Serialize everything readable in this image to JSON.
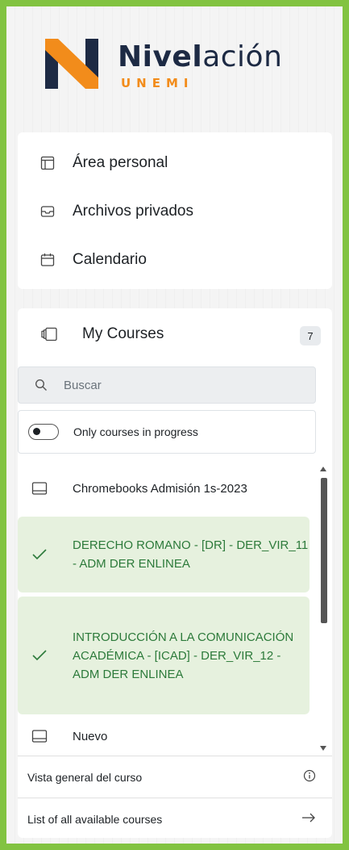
{
  "brand": {
    "word_bold": "Nivel",
    "word_rest": "ación",
    "sub": "UNEMI"
  },
  "nav": {
    "items": [
      {
        "label": "Área personal",
        "icon": "dashboard-icon"
      },
      {
        "label": "Archivos privados",
        "icon": "inbox-icon"
      },
      {
        "label": "Calendario",
        "icon": "calendar-icon"
      }
    ]
  },
  "my_courses": {
    "title": "My Courses",
    "count": "7",
    "search_placeholder": "Buscar",
    "toggle_label": "Only courses in progress",
    "courses": [
      {
        "name": "Chromebooks Admisión 1s-2023",
        "completed": false
      },
      {
        "name": "DERECHO ROMANO - [DR] - DER_VIR_11 - ADM DER ENLINEA",
        "completed": true
      },
      {
        "name": "INTRODUCCIÓN A LA COMUNICACIÓN ACADÉMICA - [ICAD] - DER_VIR_12 - ADM DER ENLINEA",
        "completed": true
      },
      {
        "name": "Nuevo",
        "completed": false
      }
    ],
    "overview_label": "Vista general del curso",
    "all_courses_label": "List of all available courses"
  },
  "colors": {
    "frame": "#82c341",
    "completed_bg": "#e6f1de",
    "completed_text": "#2c7a3a",
    "brand_dark": "#1d2a44",
    "brand_orange": "#f28c1b"
  }
}
